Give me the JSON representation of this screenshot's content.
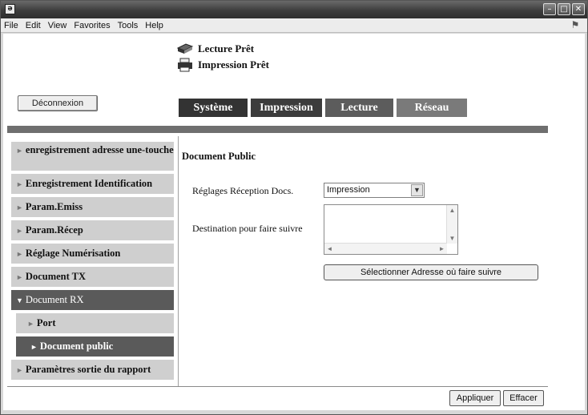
{
  "window": {
    "app_icon_glyph": "ə",
    "buttons": [
      {
        "name": "minimize",
        "glyph": "–"
      },
      {
        "name": "maximize",
        "glyph": "□"
      },
      {
        "name": "close",
        "glyph": "✕"
      }
    ]
  },
  "menubar": {
    "items": [
      "File",
      "Edit",
      "View",
      "Favorites",
      "Tools",
      "Help"
    ]
  },
  "status": {
    "read": "Lecture Prêt",
    "print": "Impression Prêt"
  },
  "logout_label": "Déconnexion",
  "tabs": [
    "Système",
    "Impression",
    "Lecture",
    "Réseau"
  ],
  "sidebar": {
    "items": [
      {
        "label": "enregistrement adresse une-touche",
        "state": "normal"
      },
      {
        "label": "Enregistrement Identification",
        "state": "normal"
      },
      {
        "label": "Param.Emiss",
        "state": "normal"
      },
      {
        "label": "Param.Récep",
        "state": "normal"
      },
      {
        "label": "Réglage Numérisation",
        "state": "normal"
      },
      {
        "label": "Document TX",
        "state": "normal"
      },
      {
        "label": "Document RX",
        "state": "expanded"
      },
      {
        "label": "Port",
        "state": "sub"
      },
      {
        "label": "Document public",
        "state": "sub-active"
      },
      {
        "label": "Paramètres sortie du rapport",
        "state": "normal"
      }
    ]
  },
  "main": {
    "section_title": "Document Public",
    "reception_label": "Réglages Réception Docs.",
    "reception_value": "Impression",
    "destination_label": "Destination pour faire suivre",
    "destination_value": "",
    "select_address_button": "Sélectionner Adresse où faire suivre"
  },
  "footer": {
    "apply_label": "Appliquer",
    "clear_label": "Effacer"
  },
  "colors": {
    "tab_active": "#333333",
    "sidebar_active": "#5a5a5a",
    "divider": "#6f6f6f"
  }
}
